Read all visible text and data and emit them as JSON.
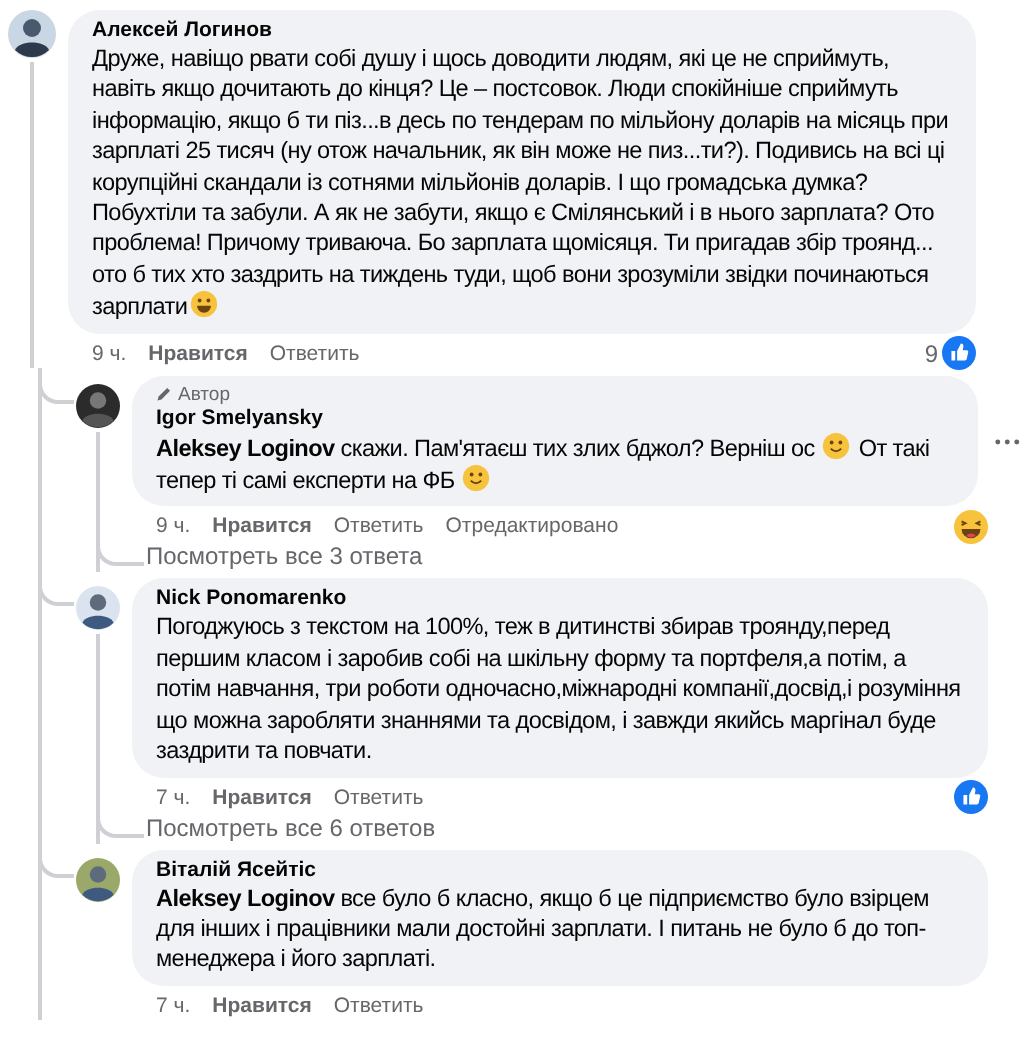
{
  "comment": {
    "author": "Алексей Логинов",
    "parts": [
      {
        "kind": "text",
        "text": "Друже, навіщо рвати собі душу і щось доводити людям, які це не сприймуть, навіть якщо дочитають до кінця? Це – постсовок. Люди спокійніше сприймуть інформацію, якщо б ти піз...в десь по тендерам по мільйону доларів на місяць при зарплаті 25 тисяч (ну отож начальник, як він може не пиз...ти?). Подивись на всі ці корупційні скандали із сотнями мільйонів доларів. І що громадська думка? Побухтіли та забули. А як не забути, якщо є Смілянський і в нього зарплата? Ото проблема! Причому триваюча. Бо зарплата щомісяця. Ти пригадав збір троянд... ото б тих хто заздрить на тиждень туди, щоб вони зрозуміли звідки починаються зарплати"
      },
      {
        "kind": "grin_emoji"
      }
    ],
    "time": "9 ч.",
    "like": "Нравится",
    "reply": "Ответить",
    "reaction": {
      "kind": "like",
      "count": "9"
    }
  },
  "replies": [
    {
      "badge": "Автор",
      "author": "Igor Smelyansky",
      "parts": [
        {
          "kind": "mention",
          "text": "Aleksey Loginov"
        },
        {
          "kind": "text",
          "text": " скажи. Пам'ятаєш тих злих бджол? Верніш ос "
        },
        {
          "kind": "smile_emoji"
        },
        {
          "kind": "text",
          "text": " От такі тепер ті самі експерти на ФБ "
        },
        {
          "kind": "smile_emoji"
        }
      ],
      "time": "9 ч.",
      "like": "Нравится",
      "reply": "Ответить",
      "edited": "Отредактировано",
      "reaction": {
        "kind": "haha"
      },
      "more_menu": true,
      "view_more": "Посмотреть все 3 ответа"
    },
    {
      "author": "Nick Ponomarenko",
      "parts": [
        {
          "kind": "text",
          "text": "Погоджуюсь з текстом на 100%, теж в дитинстві збирав троянду,перед першим класом і заробив собі на шкільну форму та портфеля,а потім, а потім навчання, три роботи одночасно,міжнародні компанії,досвід,і розуміння що можна заробляти знаннями та досвідом, і завжди якийсь маргінал буде заздрити та повчати."
        }
      ],
      "time": "7 ч.",
      "like": "Нравится",
      "reply": "Ответить",
      "reaction": {
        "kind": "like"
      },
      "view_more": "Посмотреть все 6 ответов"
    },
    {
      "author": "Віталій Ясейтіс",
      "parts": [
        {
          "kind": "mention",
          "text": "Aleksey Loginov"
        },
        {
          "kind": "text",
          "text": " все було б класно, якщо б це підприємство було взірцем для інших і працівники мали достойні зарплати. І питань не було б до топ-менеджера і його зарплаті."
        }
      ],
      "time": "7 ч.",
      "like": "Нравится",
      "reply": "Ответить"
    }
  ]
}
